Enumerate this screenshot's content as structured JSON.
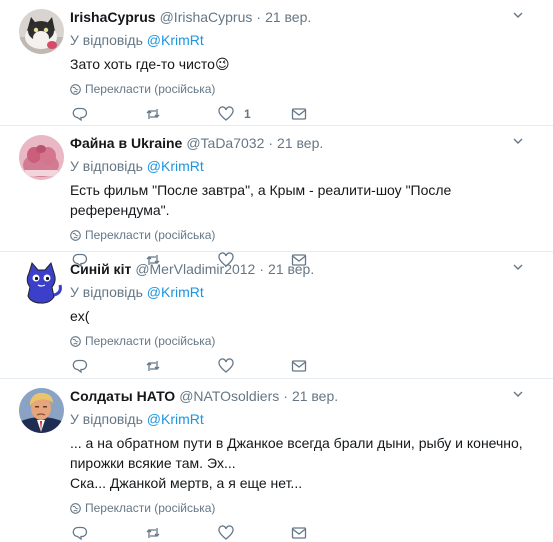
{
  "colors": {
    "link": "#1b95e0",
    "muted": "#657786",
    "text": "#14171a",
    "divider": "#e6ecf0"
  },
  "tweets": [
    {
      "name": "IrishaCyprus",
      "handle": "@IrishaCyprus",
      "dot": "·",
      "time": "21 вер.",
      "reply_prefix": "У відповідь",
      "reply_to": "@KrimRt",
      "text": "Зато хоть где-то чисто😉",
      "translate": "Перекласти (російська)",
      "like_count": "1",
      "avatar": "cat-avatar"
    },
    {
      "name": "Файна в Ukraine",
      "handle": "@TaDa7032",
      "dot": "·",
      "time": "21 вер.",
      "reply_prefix": "У відповідь",
      "reply_to": "@KrimRt",
      "text": "Есть фильм \"После завтра\", а Крым - реалити-шоу \"После референдума\".",
      "translate": "Перекласти (російська)",
      "like_count": "",
      "avatar": "pink-avatar"
    },
    {
      "name": "Синій кіт",
      "handle": "@MerVladimir2012",
      "dot": "·",
      "time": "21 вер.",
      "reply_prefix": "У відповідь",
      "reply_to": "@KrimRt",
      "text": "ex(",
      "translate": "Перекласти (російська)",
      "like_count": "",
      "avatar": "blue-cat-avatar"
    },
    {
      "name": "Солдаты НАТО",
      "handle": "@NATOsoldiers",
      "dot": "·",
      "time": "21 вер.",
      "reply_prefix": "У відповідь",
      "reply_to": "@KrimRt",
      "text_lines": [
        "... а на обратном пути в Джанкое всегда брали дыни, рыбу и конечно,",
        "пирожки всякие там. Эх...",
        "Ска... Джанкой мертв, а я еще нет..."
      ],
      "translate": "Перекласти (російська)",
      "like_count": "",
      "avatar": "man-avatar"
    }
  ]
}
